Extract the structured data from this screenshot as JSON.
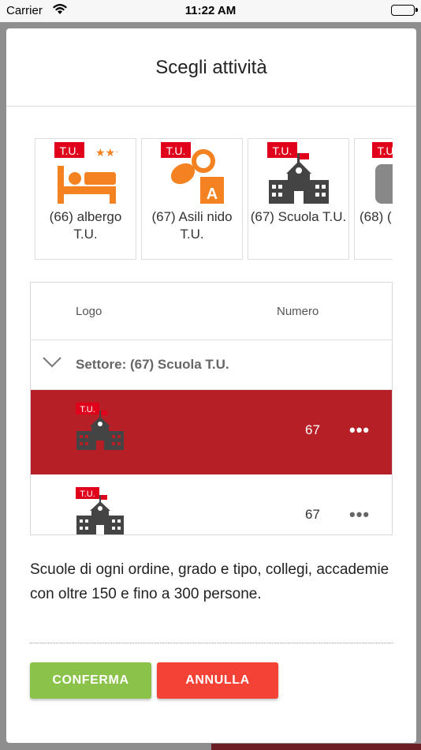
{
  "status_bar": {
    "carrier": "Carrier",
    "time": "11:22 AM"
  },
  "modal": {
    "title": "Scegli attività",
    "carousel": [
      {
        "label": "(66) albergo T.U.",
        "icon": "hotel-bed-icon",
        "badge": "T.U."
      },
      {
        "label": "(67) Asili nido T.U.",
        "icon": "pacifier-icon",
        "badge": "T.U."
      },
      {
        "label": "(67) Scuola T.U.",
        "icon": "school-building-icon",
        "badge": "T.U."
      },
      {
        "label": "(68) (",
        "icon": "generic-activity-icon",
        "badge": "T.U."
      }
    ],
    "table": {
      "headers": {
        "logo": "Logo",
        "number": "Numero"
      },
      "group_label": "Settore: (67) Scuola T.U.",
      "rows": [
        {
          "number": "67",
          "badge": "T.U.",
          "selected": true,
          "more": "•••"
        },
        {
          "number": "67",
          "badge": "T.U.",
          "selected": false,
          "more": "•••"
        }
      ]
    },
    "description": "Scuole di ogni ordine, grado e tipo, collegi, accademie con oltre 150 e fino a 300 persone.",
    "buttons": {
      "confirm": "CONFERMA",
      "cancel": "ANNULLA"
    }
  },
  "colors": {
    "selected_row": "#b71f27",
    "confirm": "#8bc34a",
    "cancel": "#f44336",
    "accent_orange": "#f58220"
  }
}
